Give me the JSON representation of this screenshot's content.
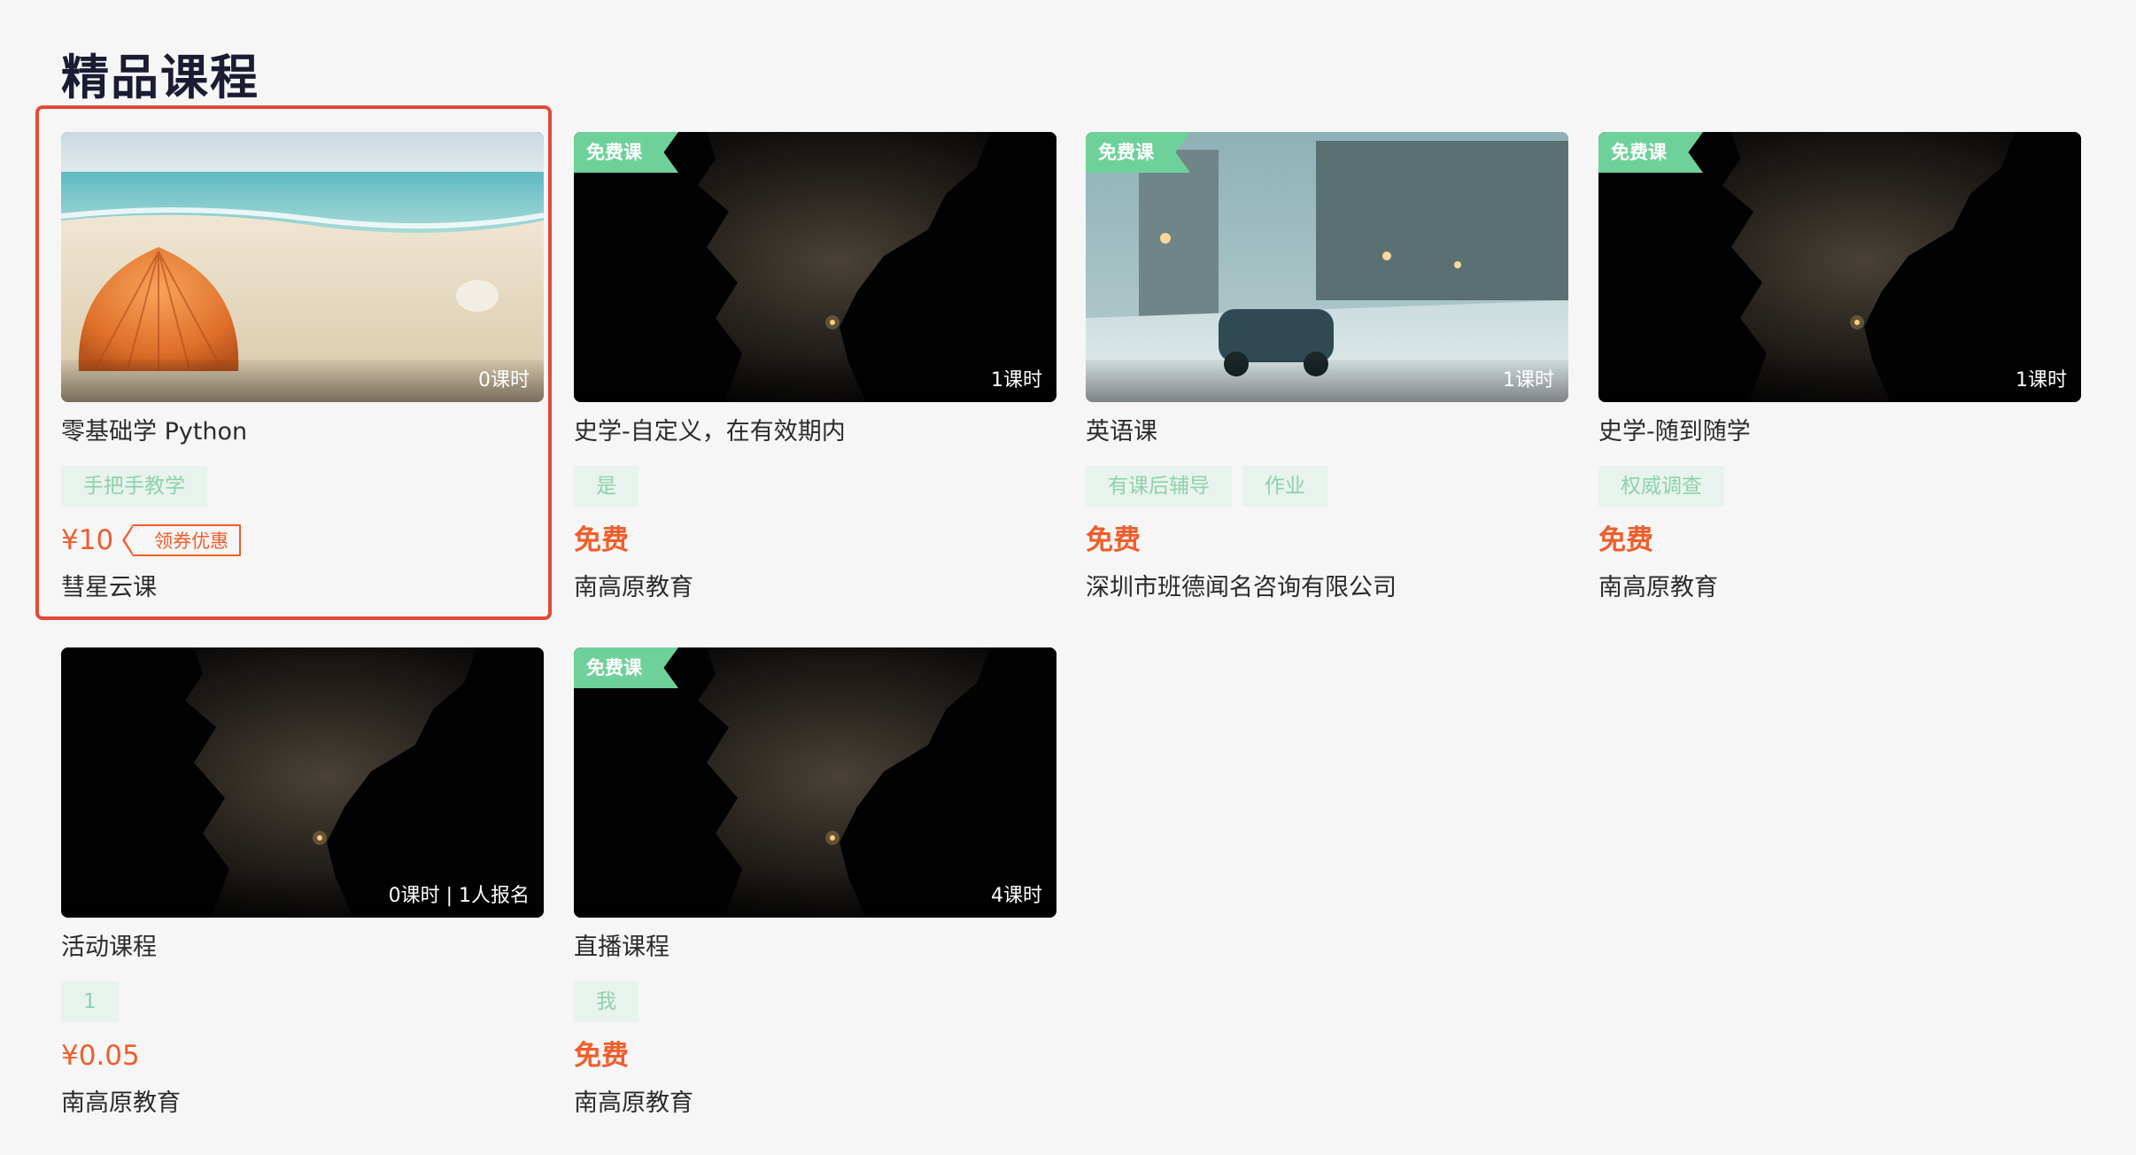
{
  "section": {
    "title": "精品课程"
  },
  "courses": [
    {
      "title": "零基础学 Python",
      "lesson_meta": "0课时",
      "cover": "beach-seashell",
      "free_badge": "",
      "tags": [
        "手把手教学"
      ],
      "price": "¥10",
      "is_free": false,
      "coupon": "领券优惠",
      "org": "彗星云课",
      "selected": true
    },
    {
      "title": "史学-自定义，在有效期内",
      "lesson_meta": "1课时",
      "cover": "night-trees",
      "free_badge": "免费课",
      "tags": [
        "是"
      ],
      "price": "免费",
      "is_free": true,
      "coupon": "",
      "org": "南高原教育",
      "selected": false
    },
    {
      "title": "英语课",
      "lesson_meta": "1课时",
      "cover": "snowy-street",
      "free_badge": "免费课",
      "tags": [
        "有课后辅导",
        "作业"
      ],
      "price": "免费",
      "is_free": true,
      "coupon": "",
      "org": "深圳市班德闻名咨询有限公司",
      "selected": false
    },
    {
      "title": "史学-随到随学",
      "lesson_meta": "1课时",
      "cover": "night-trees",
      "free_badge": "免费课",
      "tags": [
        "权威调查"
      ],
      "price": "免费",
      "is_free": true,
      "coupon": "",
      "org": "南高原教育",
      "selected": false
    },
    {
      "title": "活动课程",
      "lesson_meta": "0课时 | 1人报名",
      "cover": "night-trees",
      "free_badge": "",
      "tags": [
        "1"
      ],
      "price": "¥0.05",
      "is_free": false,
      "coupon": "",
      "org": "南高原教育",
      "selected": false
    },
    {
      "title": "直播课程",
      "lesson_meta": "4课时",
      "cover": "night-trees",
      "free_badge": "免费课",
      "tags": [
        "我"
      ],
      "price": "免费",
      "is_free": true,
      "coupon": "",
      "org": "南高原教育",
      "selected": false
    }
  ],
  "colors": {
    "accent_price": "#ef5e2c",
    "selection_border": "#e24a37",
    "free_badge": "#6fd19a",
    "tag_bg": "#e7f3ec",
    "tag_text": "#8fd1ac"
  }
}
